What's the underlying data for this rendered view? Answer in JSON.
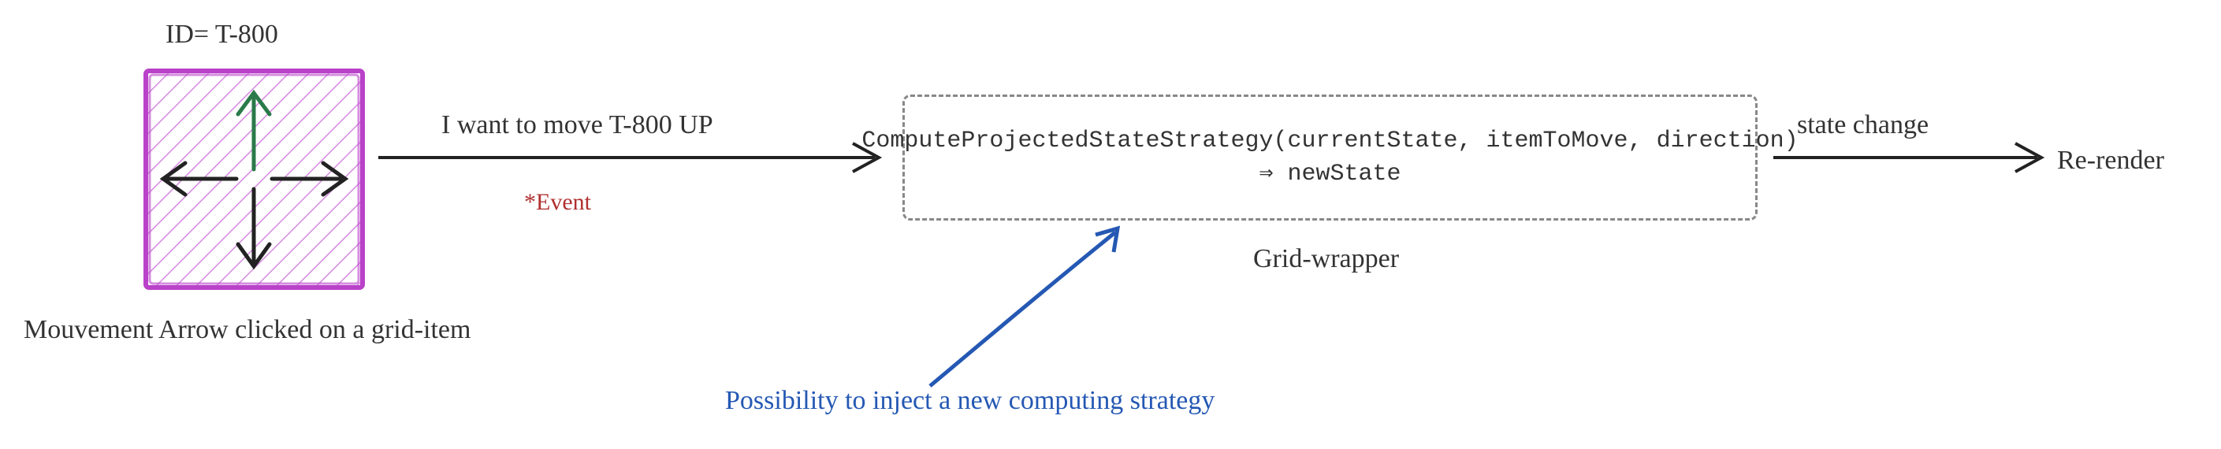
{
  "grid_item": {
    "id_label": "ID= T-800",
    "caption": "Mouvement Arrow clicked on a grid-item",
    "arrows": {
      "up": "up-arrow",
      "down": "down-arrow",
      "left": "left-arrow",
      "right": "right-arrow"
    }
  },
  "event_arrow": {
    "label": "I want to move T-800 UP",
    "note": "*Event"
  },
  "strategy_box": {
    "code_line1": "ComputeProjectedStateStrategy(currentState, itemToMove, direction)",
    "code_line2": "⇒ newState",
    "caption": "Grid-wrapper"
  },
  "injection": {
    "label": "Possibility to inject a new computing strategy"
  },
  "state_arrow": {
    "label": "state change"
  },
  "result": {
    "label": "Re-render"
  },
  "colors": {
    "box_fill": "#e9b9f0",
    "box_stroke": "#b942c9",
    "up_arrow": "#2a7a4a",
    "inject": "#2458b3",
    "event": "#b03030"
  }
}
